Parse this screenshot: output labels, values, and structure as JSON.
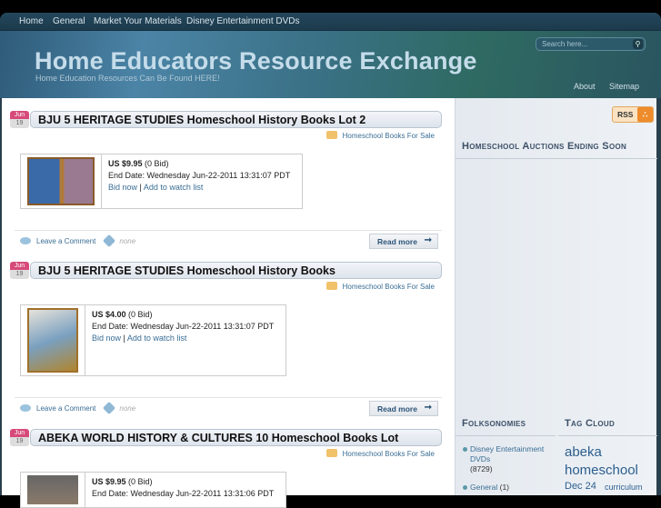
{
  "nav": {
    "items": [
      "Home",
      "General",
      "Market Your Materials",
      "Disney Entertainment DVDs"
    ]
  },
  "header": {
    "title": "Home Educators Resource Exchange",
    "tagline": "Home Education Resources Can Be Found HERE!",
    "search_placeholder": "Search here...",
    "links": [
      "About",
      "Sitemap"
    ]
  },
  "posts": [
    {
      "month": "Jun",
      "day": "19",
      "title": "BJU 5 HERITAGE STUDIES Homeschool History Books Lot 2",
      "category": "Homeschool Books For Sale",
      "price": "US $9.95",
      "bids": "(0 Bid)",
      "end": "End Date: Wednesday Jun-22-2011 13:31:07 PDT",
      "bid_now": "Bid now",
      "sep": "|",
      "watch": "Add to watch list",
      "comment": "Leave a Comment",
      "tags": "none",
      "read_more": "Read more"
    },
    {
      "month": "Jun",
      "day": "19",
      "title": "BJU 5 HERITAGE STUDIES Homeschool History Books",
      "category": "Homeschool Books For Sale",
      "price": "US $4.00",
      "bids": "(0 Bid)",
      "end": "End Date: Wednesday Jun-22-2011 13:31:07 PDT",
      "bid_now": "Bid now",
      "sep": "|",
      "watch": "Add to watch list",
      "comment": "Leave a Comment",
      "tags": "none",
      "read_more": "Read more"
    },
    {
      "month": "Jun",
      "day": "19",
      "title": "ABEKA WORLD HISTORY & CULTURES 10 Homeschool Books Lot",
      "category": "Homeschool Books For Sale",
      "price": "US $9.95",
      "bids": "(0 Bid)",
      "end": "End Date: Wednesday Jun-22-2011 13:31:06 PDT"
    }
  ],
  "sidebar": {
    "rss": "RSS",
    "auctions_heading": "Homeschool Auctions Ending Soon",
    "folk_heading": "Folksonomies",
    "tag_heading": "Tag Cloud",
    "folksonomies": [
      {
        "label": "Disney Entertainment DVDs",
        "count": "(8729)"
      },
      {
        "label": "General",
        "count": "(1)"
      }
    ],
    "tags": [
      "abeka",
      "homeschool",
      "Dec 24",
      "curriculum"
    ]
  }
}
